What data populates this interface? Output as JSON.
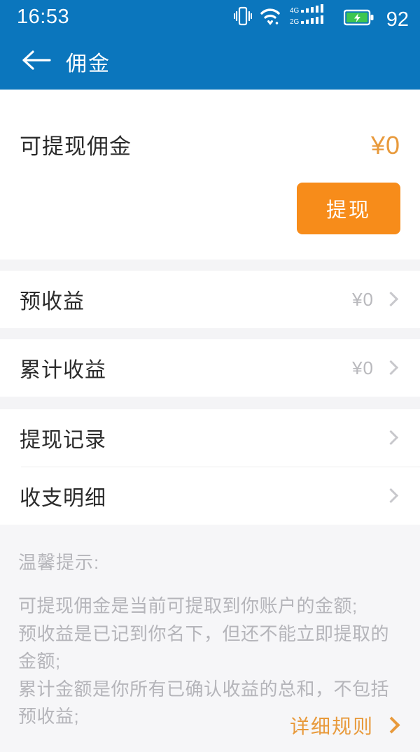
{
  "status_bar": {
    "time": "16:53",
    "battery_level": "92",
    "icons": [
      "vibrate-icon",
      "wifi-icon",
      "signal-4g-icon",
      "signal-2g-icon",
      "battery-charging-icon"
    ],
    "sim1_label": "4G",
    "sim2_label": "2G",
    "background_color": "#0b76bd"
  },
  "header": {
    "title": "佣金",
    "back_icon": "arrow-left-icon",
    "background_color": "#0b76bd",
    "text_color": "#ffffff"
  },
  "balance": {
    "label": "可提现佣金",
    "amount": "¥0",
    "amount_color": "#e89a3c",
    "withdraw_label": "提现",
    "withdraw_button_color": "#f78c1a"
  },
  "list_group_1": [
    {
      "label": "预收益",
      "value": "¥0",
      "chevron": "chevron-right-icon"
    },
    {
      "label": "累计收益",
      "value": "¥0",
      "chevron": "chevron-right-icon"
    }
  ],
  "list_group_2": [
    {
      "label": "提现记录",
      "value": "",
      "chevron": "chevron-right-icon"
    },
    {
      "label": "收支明细",
      "value": "",
      "chevron": "chevron-right-icon"
    }
  ],
  "tips": {
    "title": "温馨提示:",
    "body": "可提现佣金是当前可提取到你账户的金额;\n预收益是已记到你名下，但还不能立即提取的金额;\n累计金额是你所有已确认收益的总和，不包括预收益;",
    "text_color": "#b5b5ba",
    "background_color": "#f6f6f8"
  },
  "rules": {
    "label": "详细规则",
    "chevron": "chevron-right-icon",
    "color": "#e89a3c"
  }
}
